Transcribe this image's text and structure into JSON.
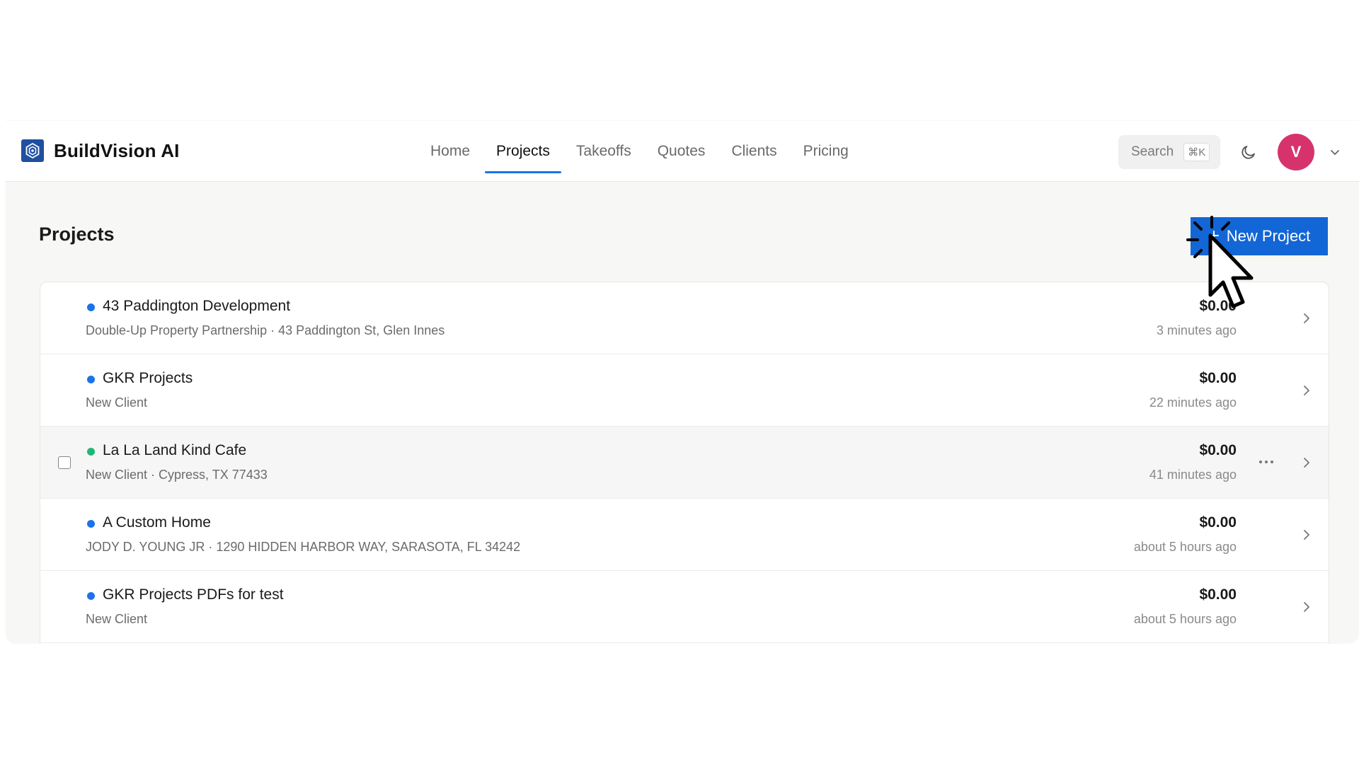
{
  "brand": {
    "name": "BuildVision AI",
    "logo_icon": "hexagon-shield-icon",
    "logo_color": "#1f4fa0"
  },
  "nav": {
    "items": [
      {
        "label": "Home",
        "active": false
      },
      {
        "label": "Projects",
        "active": true
      },
      {
        "label": "Takeoffs",
        "active": false
      },
      {
        "label": "Quotes",
        "active": false
      },
      {
        "label": "Clients",
        "active": false
      },
      {
        "label": "Pricing",
        "active": false
      }
    ],
    "accent": "#1a73e8"
  },
  "search": {
    "label": "Search",
    "shortcut": "⌘K"
  },
  "theme_toggle_icon": "moon-icon",
  "user": {
    "initial": "V",
    "avatar_color": "#d6336c"
  },
  "page": {
    "title": "Projects",
    "new_button_label": "New Project",
    "button_color": "#1366d6"
  },
  "projects": [
    {
      "title": "43 Paddington Development",
      "subtitle": "Double-Up Property Partnership · 43 Paddington St, Glen Innes",
      "amount": "$0.00",
      "time": "3 minutes ago",
      "status_color": "#1a73e8"
    },
    {
      "title": "GKR Projects",
      "subtitle": "New Client",
      "amount": "$0.00",
      "time": "22 minutes ago",
      "status_color": "#1a73e8"
    },
    {
      "title": "La La Land Kind Cafe",
      "subtitle": "New Client · Cypress, TX 77433",
      "amount": "$0.00",
      "time": "41 minutes ago",
      "status_color": "#22b573",
      "hovered": true
    },
    {
      "title": "A Custom Home",
      "subtitle": "JODY D. YOUNG JR · 1290 HIDDEN HARBOR WAY, SARASOTA, FL 34242",
      "amount": "$0.00",
      "time": "about 5 hours ago",
      "status_color": "#1a73e8"
    },
    {
      "title": "GKR Projects PDFs for test",
      "subtitle": "New Client",
      "amount": "$0.00",
      "time": "about 5 hours ago",
      "status_color": "#1a73e8"
    }
  ]
}
